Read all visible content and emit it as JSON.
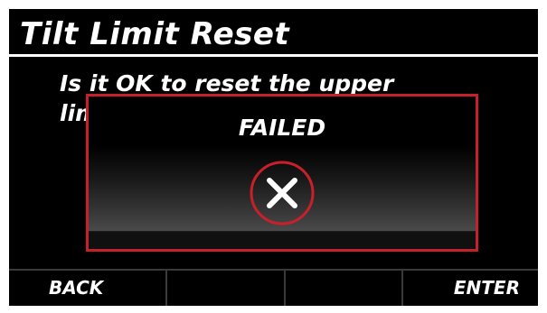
{
  "title": "Tilt Limit Reset",
  "message": {
    "line1": "Is it OK to reset the upper",
    "line2": "lim"
  },
  "dialog": {
    "status": "FAILED",
    "icon": "x-circle-icon",
    "border_color": "#c8202a"
  },
  "softkeys": {
    "back_label": "BACK",
    "key2_label": "",
    "key3_label": "",
    "enter_label": "ENTER"
  },
  "colors": {
    "background": "#000000",
    "text": "#ffffff",
    "alert_red": "#c8202a"
  }
}
